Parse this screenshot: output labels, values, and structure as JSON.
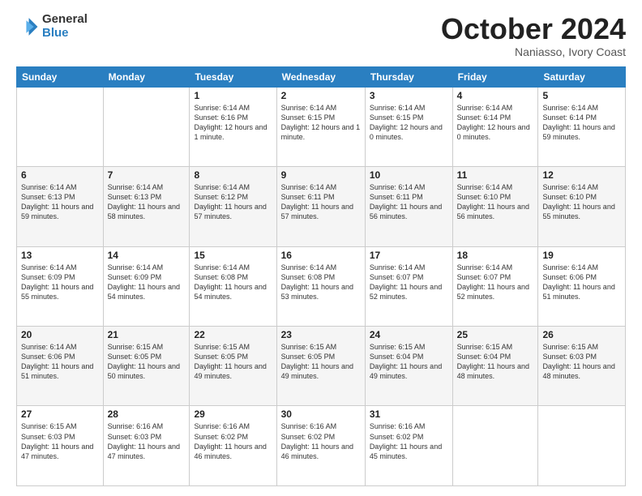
{
  "header": {
    "logo_general": "General",
    "logo_blue": "Blue",
    "month": "October 2024",
    "location": "Naniasso, Ivory Coast"
  },
  "days_of_week": [
    "Sunday",
    "Monday",
    "Tuesday",
    "Wednesday",
    "Thursday",
    "Friday",
    "Saturday"
  ],
  "weeks": [
    [
      {
        "day": "",
        "text": ""
      },
      {
        "day": "",
        "text": ""
      },
      {
        "day": "1",
        "text": "Sunrise: 6:14 AM\nSunset: 6:16 PM\nDaylight: 12 hours and 1 minute."
      },
      {
        "day": "2",
        "text": "Sunrise: 6:14 AM\nSunset: 6:15 PM\nDaylight: 12 hours and 1 minute."
      },
      {
        "day": "3",
        "text": "Sunrise: 6:14 AM\nSunset: 6:15 PM\nDaylight: 12 hours and 0 minutes."
      },
      {
        "day": "4",
        "text": "Sunrise: 6:14 AM\nSunset: 6:14 PM\nDaylight: 12 hours and 0 minutes."
      },
      {
        "day": "5",
        "text": "Sunrise: 6:14 AM\nSunset: 6:14 PM\nDaylight: 11 hours and 59 minutes."
      }
    ],
    [
      {
        "day": "6",
        "text": "Sunrise: 6:14 AM\nSunset: 6:13 PM\nDaylight: 11 hours and 59 minutes."
      },
      {
        "day": "7",
        "text": "Sunrise: 6:14 AM\nSunset: 6:13 PM\nDaylight: 11 hours and 58 minutes."
      },
      {
        "day": "8",
        "text": "Sunrise: 6:14 AM\nSunset: 6:12 PM\nDaylight: 11 hours and 57 minutes."
      },
      {
        "day": "9",
        "text": "Sunrise: 6:14 AM\nSunset: 6:11 PM\nDaylight: 11 hours and 57 minutes."
      },
      {
        "day": "10",
        "text": "Sunrise: 6:14 AM\nSunset: 6:11 PM\nDaylight: 11 hours and 56 minutes."
      },
      {
        "day": "11",
        "text": "Sunrise: 6:14 AM\nSunset: 6:10 PM\nDaylight: 11 hours and 56 minutes."
      },
      {
        "day": "12",
        "text": "Sunrise: 6:14 AM\nSunset: 6:10 PM\nDaylight: 11 hours and 55 minutes."
      }
    ],
    [
      {
        "day": "13",
        "text": "Sunrise: 6:14 AM\nSunset: 6:09 PM\nDaylight: 11 hours and 55 minutes."
      },
      {
        "day": "14",
        "text": "Sunrise: 6:14 AM\nSunset: 6:09 PM\nDaylight: 11 hours and 54 minutes."
      },
      {
        "day": "15",
        "text": "Sunrise: 6:14 AM\nSunset: 6:08 PM\nDaylight: 11 hours and 54 minutes."
      },
      {
        "day": "16",
        "text": "Sunrise: 6:14 AM\nSunset: 6:08 PM\nDaylight: 11 hours and 53 minutes."
      },
      {
        "day": "17",
        "text": "Sunrise: 6:14 AM\nSunset: 6:07 PM\nDaylight: 11 hours and 52 minutes."
      },
      {
        "day": "18",
        "text": "Sunrise: 6:14 AM\nSunset: 6:07 PM\nDaylight: 11 hours and 52 minutes."
      },
      {
        "day": "19",
        "text": "Sunrise: 6:14 AM\nSunset: 6:06 PM\nDaylight: 11 hours and 51 minutes."
      }
    ],
    [
      {
        "day": "20",
        "text": "Sunrise: 6:14 AM\nSunset: 6:06 PM\nDaylight: 11 hours and 51 minutes."
      },
      {
        "day": "21",
        "text": "Sunrise: 6:15 AM\nSunset: 6:05 PM\nDaylight: 11 hours and 50 minutes."
      },
      {
        "day": "22",
        "text": "Sunrise: 6:15 AM\nSunset: 6:05 PM\nDaylight: 11 hours and 49 minutes."
      },
      {
        "day": "23",
        "text": "Sunrise: 6:15 AM\nSunset: 6:05 PM\nDaylight: 11 hours and 49 minutes."
      },
      {
        "day": "24",
        "text": "Sunrise: 6:15 AM\nSunset: 6:04 PM\nDaylight: 11 hours and 49 minutes."
      },
      {
        "day": "25",
        "text": "Sunrise: 6:15 AM\nSunset: 6:04 PM\nDaylight: 11 hours and 48 minutes."
      },
      {
        "day": "26",
        "text": "Sunrise: 6:15 AM\nSunset: 6:03 PM\nDaylight: 11 hours and 48 minutes."
      }
    ],
    [
      {
        "day": "27",
        "text": "Sunrise: 6:15 AM\nSunset: 6:03 PM\nDaylight: 11 hours and 47 minutes."
      },
      {
        "day": "28",
        "text": "Sunrise: 6:16 AM\nSunset: 6:03 PM\nDaylight: 11 hours and 47 minutes."
      },
      {
        "day": "29",
        "text": "Sunrise: 6:16 AM\nSunset: 6:02 PM\nDaylight: 11 hours and 46 minutes."
      },
      {
        "day": "30",
        "text": "Sunrise: 6:16 AM\nSunset: 6:02 PM\nDaylight: 11 hours and 46 minutes."
      },
      {
        "day": "31",
        "text": "Sunrise: 6:16 AM\nSunset: 6:02 PM\nDaylight: 11 hours and 45 minutes."
      },
      {
        "day": "",
        "text": ""
      },
      {
        "day": "",
        "text": ""
      }
    ]
  ]
}
